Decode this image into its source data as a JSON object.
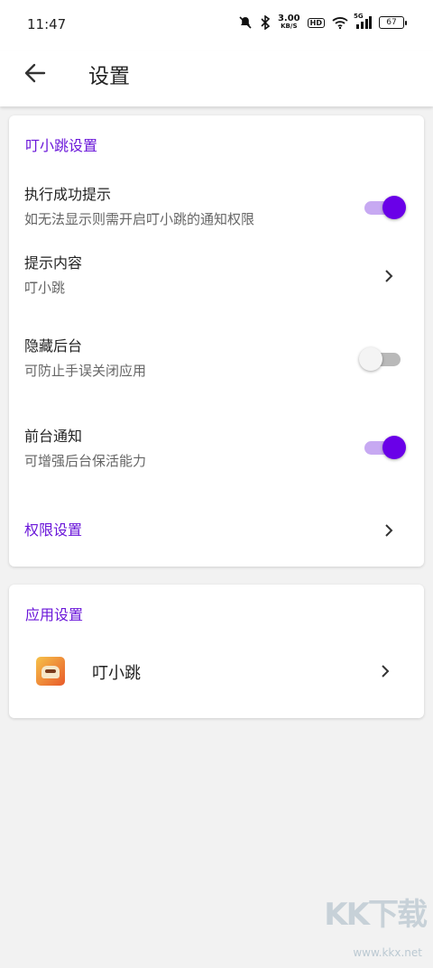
{
  "status_bar": {
    "time": "11:47",
    "net_speed_value": "3.00",
    "net_speed_unit": "KB/S",
    "hd_label": "HD",
    "signal_label": "5G",
    "battery": "67",
    "icons": [
      "mute-bell-icon",
      "bluetooth-icon",
      "wifi-icon",
      "signal-icon",
      "battery-icon"
    ]
  },
  "app_bar": {
    "title": "设置"
  },
  "card_dingxiaotiao": {
    "section_title": "叮小跳设置",
    "rows": [
      {
        "title": "执行成功提示",
        "subtitle": "如无法显示则需开启叮小跳的通知权限",
        "control": "switch",
        "on": true
      },
      {
        "title": "提示内容",
        "subtitle": "叮小跳",
        "control": "chevron"
      },
      {
        "title": "隐藏后台",
        "subtitle": "可防止手误关闭应用",
        "control": "switch",
        "on": false
      },
      {
        "title": "前台通知",
        "subtitle": "可增强后台保活能力",
        "control": "switch",
        "on": true
      }
    ],
    "permission_link": "权限设置"
  },
  "card_app": {
    "section_title": "应用设置",
    "app_name": "叮小跳"
  },
  "watermark": {
    "logo": "KK下载",
    "url": "www.kkx.net"
  },
  "colors": {
    "accent": "#6a16d9",
    "switch_on": "#6a00e8",
    "switch_track_on": "#c7a9f2"
  }
}
